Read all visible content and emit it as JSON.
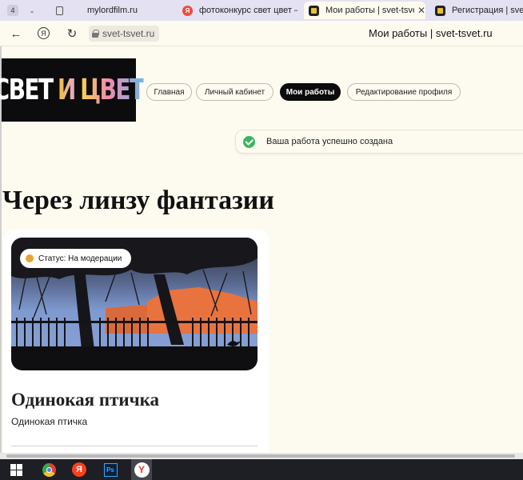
{
  "browser": {
    "tab_count": "4",
    "tabs": [
      {
        "title": "mylordfilm.ru",
        "icon": "page-icon"
      },
      {
        "title": "фотоконкурс свет цвет –",
        "icon": "yandex-icon"
      },
      {
        "title": "Мои работы | svet-tsvet",
        "icon": "site-icon",
        "close": "✕"
      },
      {
        "title": "Регистрация | svet-",
        "icon": "site-icon"
      }
    ],
    "address": "svet-tsvet.ru",
    "page_title": "Мои работы | svet-tsvet.ru",
    "yandex_button": "Я"
  },
  "site": {
    "logo": {
      "word1": "СВЕТ",
      "word2": "И",
      "word3": "ЦВЕТ"
    },
    "nav": [
      {
        "label": "Главная"
      },
      {
        "label": "Личный кабинет"
      },
      {
        "label": "Мои работы",
        "active": true
      },
      {
        "label": "Редактирование профиля"
      }
    ],
    "notice": "Ваша работа успешно создана",
    "title": "Через линзу фантазии",
    "work": {
      "status": "Статус: На модерации",
      "title": "Одинокая птичка",
      "description": "Одинокая птичка"
    }
  },
  "taskbar": {
    "items": [
      "windows-start-icon",
      "chrome-icon",
      "yandex-icon",
      "photoshop-icon",
      "yandex-browser-icon"
    ],
    "ya_label": "Я",
    "ps_label": "Ps",
    "yb_label": "Y"
  },
  "colors": {
    "page_bg": "#fdfbf0",
    "success": "#3bb55d",
    "status_moderation": "#e3a533",
    "logo_bg": "#0c0c0e"
  }
}
